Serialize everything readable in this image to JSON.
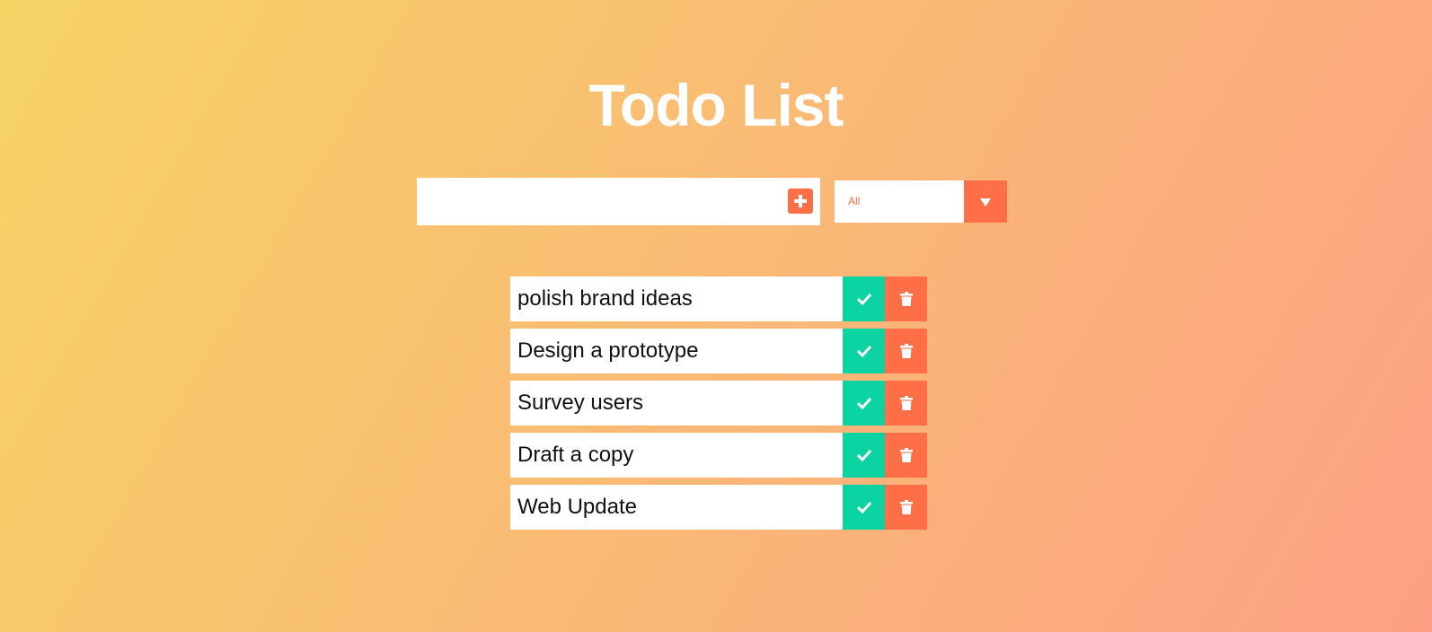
{
  "header": {
    "title": "Todo List"
  },
  "form": {
    "input_value": "",
    "input_placeholder": "",
    "add_icon": "plus-square-icon"
  },
  "filter": {
    "selected": "All",
    "arrow_icon": "caret-down-icon"
  },
  "todos": [
    {
      "text": "polish brand ideas"
    },
    {
      "text": "Design a prototype"
    },
    {
      "text": "Survey users"
    },
    {
      "text": "Draft a copy"
    },
    {
      "text": "Web Update"
    }
  ],
  "colors": {
    "gradient_start": "#f6d365",
    "gradient_end": "#fda085",
    "accent": "#ff6f47",
    "complete": "#0bd4a2",
    "text": "#111111"
  }
}
